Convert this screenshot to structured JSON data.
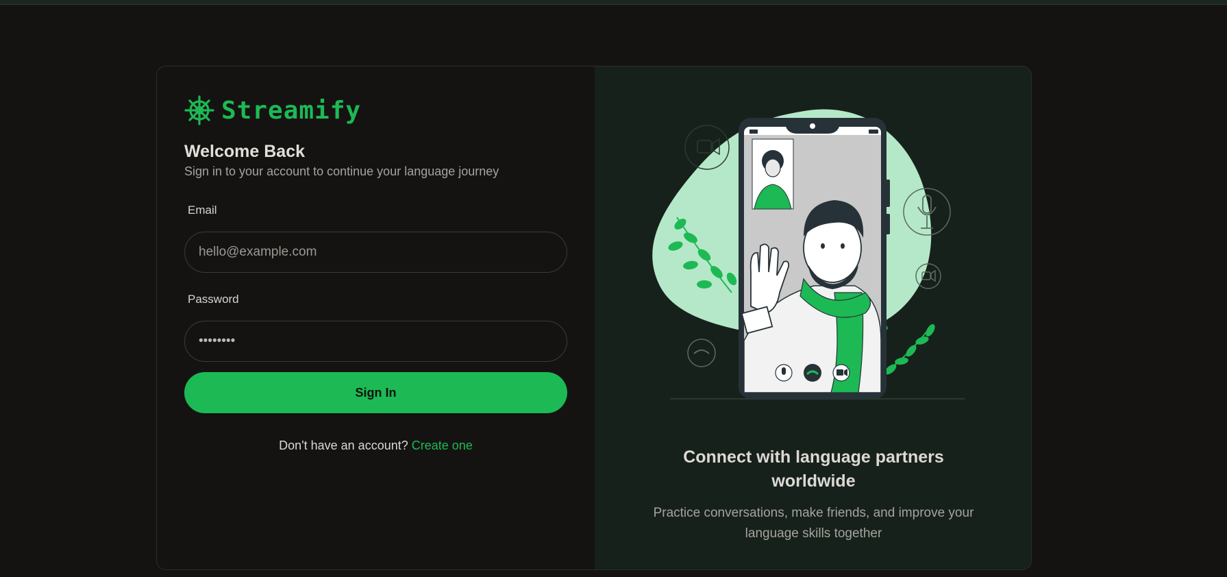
{
  "app": {
    "name": "Streamify",
    "logo_icon": "ship-wheel-icon",
    "accent_color": "#1db954"
  },
  "login": {
    "title": "Welcome Back",
    "subtitle": "Sign in to your account to continue your language journey",
    "email_label": "Email",
    "email_placeholder": "hello@example.com",
    "password_label": "Password",
    "password_value": "password",
    "sign_in_label": "Sign In",
    "no_account_text": "Don't have an account?",
    "create_link": "Create one"
  },
  "promo": {
    "illustration_icon": "video-call-illustration",
    "heading": "Connect with language partners worldwide",
    "description": "Practice conversations, make friends, and improve your language skills together"
  }
}
